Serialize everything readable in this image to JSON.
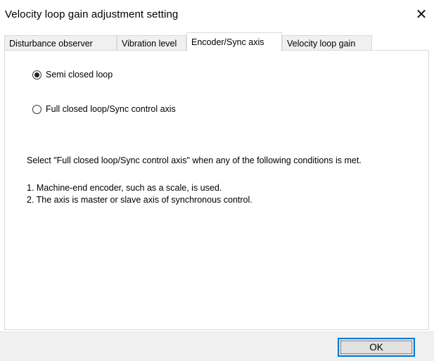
{
  "window": {
    "title": "Velocity loop gain adjustment setting",
    "close_glyph": "✕"
  },
  "tabs": [
    {
      "label": "Disturbance observer",
      "active": false
    },
    {
      "label": "Vibration level",
      "active": false
    },
    {
      "label": "Encoder/Sync axis",
      "active": true
    },
    {
      "label": "Velocity loop gain",
      "active": false
    }
  ],
  "options": {
    "semi_closed": {
      "label": "Semi closed loop",
      "checked": true
    },
    "full_closed": {
      "label": "Full closed loop/Sync control axis",
      "checked": false
    }
  },
  "description": {
    "intro": "Select \"Full closed loop/Sync control axis\" when any of the following conditions is met.",
    "condition_1": "1. Machine-end encoder, such as a scale, is used.",
    "condition_2": "2. The axis is master or slave axis of synchronous control."
  },
  "footer": {
    "ok_label": "OK"
  }
}
